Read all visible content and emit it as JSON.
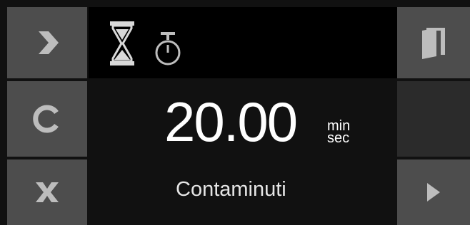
{
  "display": {
    "time_value": "20.00",
    "unit_top": "min",
    "unit_bottom": "sec",
    "mode_label": "Contaminuti"
  },
  "icons": {
    "left_top": "chevron-right-icon",
    "left_middle": "c-icon",
    "left_bottom": "x-icon",
    "top_mode_1": "hourglass-icon",
    "top_mode_2": "stopwatch-icon",
    "right_top": "door-icon",
    "right_bottom": "play-icon"
  },
  "colors": {
    "panel": "#111111",
    "button": "#4d4d4d",
    "icon": "#bdbdbd",
    "text": "#ffffff"
  }
}
